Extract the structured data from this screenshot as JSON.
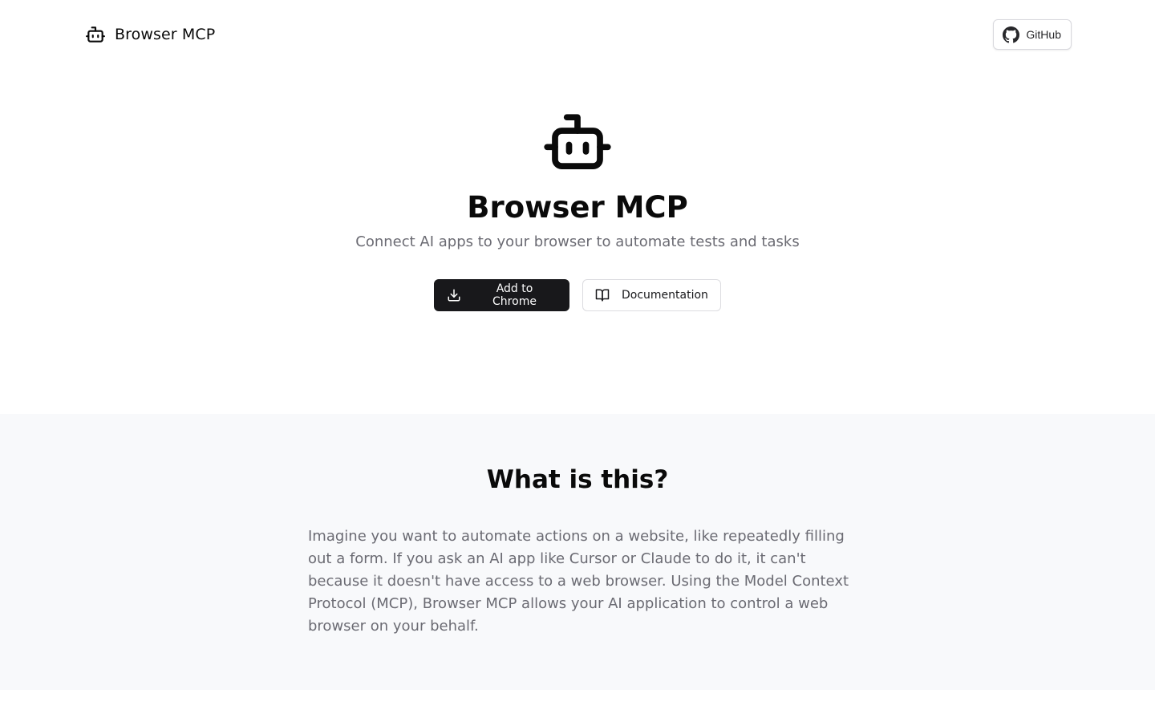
{
  "header": {
    "brand_name": "Browser MCP",
    "brand_icon": "bot-icon",
    "github_label": "GitHub",
    "github_icon": "github-icon"
  },
  "hero": {
    "icon": "bot-icon",
    "title": "Browser MCP",
    "subtitle": "Connect AI apps to your browser to automate tests and tasks",
    "primary_button": {
      "label": "Add to Chrome",
      "icon": "download-icon"
    },
    "secondary_button": {
      "label": "Documentation",
      "icon": "book-open-icon"
    }
  },
  "about": {
    "title": "What is this?",
    "body": "Imagine you want to automate actions on a website, like repeatedly filling out a form. If you ask an AI app like Cursor or Claude to do it, it can't because it doesn't have access to a web browser. Using the Model Context Protocol (MCP), Browser MCP allows your AI application to control a web browser on your behalf."
  },
  "colors": {
    "primary_button_bg": "#18181b",
    "about_bg": "#f8f9fb",
    "muted_text": "#6b6b73"
  }
}
